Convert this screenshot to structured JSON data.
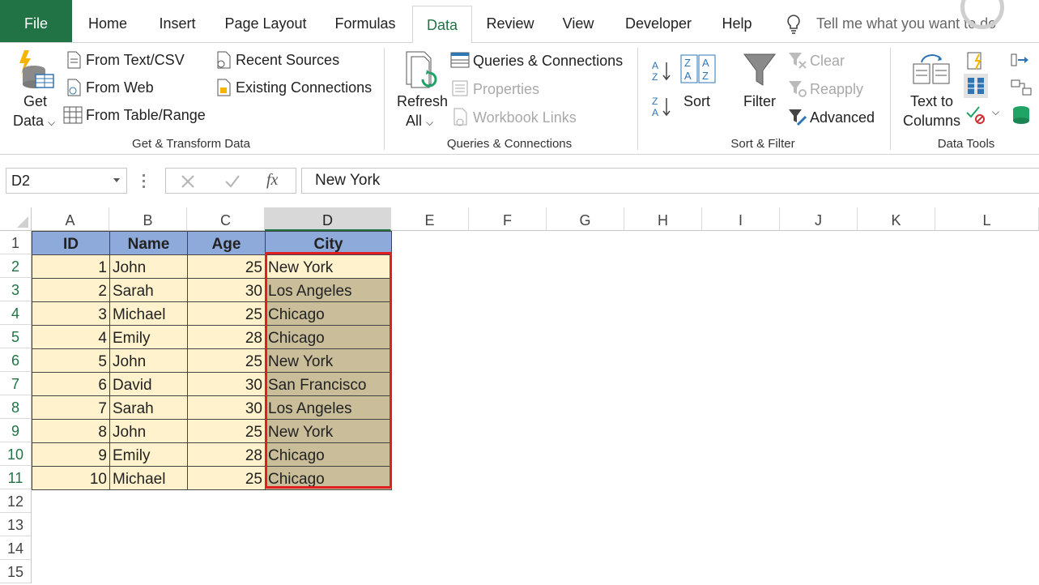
{
  "tabs": [
    "File",
    "Home",
    "Insert",
    "Page Layout",
    "Formulas",
    "Data",
    "Review",
    "View",
    "Developer",
    "Help"
  ],
  "active_tab": "Data",
  "tell_me": "Tell me what you want to do",
  "ribbon": {
    "get_data": [
      "Get",
      "Data"
    ],
    "from_text_csv": "From Text/CSV",
    "from_web": "From Web",
    "from_table_range": "From Table/Range",
    "recent_sources": "Recent Sources",
    "existing_connections": "Existing Connections",
    "group_get_transform": "Get & Transform Data",
    "refresh_all": [
      "Refresh",
      "All"
    ],
    "queries_connections": "Queries & Connections",
    "properties": "Properties",
    "workbook_links": "Workbook Links",
    "group_queries": "Queries & Connections",
    "sort": "Sort",
    "filter": "Filter",
    "clear": "Clear",
    "reapply": "Reapply",
    "advanced": "Advanced",
    "group_sort_filter": "Sort & Filter",
    "text_to_columns": [
      "Text to",
      "Columns"
    ],
    "group_data_tools": "Data Tools"
  },
  "formula_bar": {
    "name_box": "D2",
    "fx": "fx",
    "value": "New York"
  },
  "columns": [
    "A",
    "B",
    "C",
    "D",
    "E",
    "F",
    "G",
    "H",
    "I",
    "J",
    "K",
    "L"
  ],
  "rows": [
    "1",
    "2",
    "3",
    "4",
    "5",
    "6",
    "7",
    "8",
    "9",
    "10",
    "11",
    "12",
    "13",
    "14",
    "15"
  ],
  "table": {
    "headers": [
      "ID",
      "Name",
      "Age",
      "City"
    ],
    "rows": [
      [
        "1",
        "John",
        "25",
        "New York"
      ],
      [
        "2",
        "Sarah",
        "30",
        "Los Angeles"
      ],
      [
        "3",
        "Michael",
        "25",
        "Chicago"
      ],
      [
        "4",
        "Emily",
        "28",
        "Chicago"
      ],
      [
        "5",
        "John",
        "25",
        "New York"
      ],
      [
        "6",
        "David",
        "30",
        "San Francisco"
      ],
      [
        "7",
        "Sarah",
        "30",
        "Los Angeles"
      ],
      [
        "8",
        "John",
        "25",
        "New York"
      ],
      [
        "9",
        "Emily",
        "28",
        "Chicago"
      ],
      [
        "10",
        "Michael",
        "25",
        "Chicago"
      ]
    ]
  },
  "colors": {
    "excel_green": "#217346",
    "header_fill": "#8eaadb",
    "data_fill": "#fff2cc",
    "selected_fill": "#c9bd9a",
    "selection_border": "#e02020"
  }
}
